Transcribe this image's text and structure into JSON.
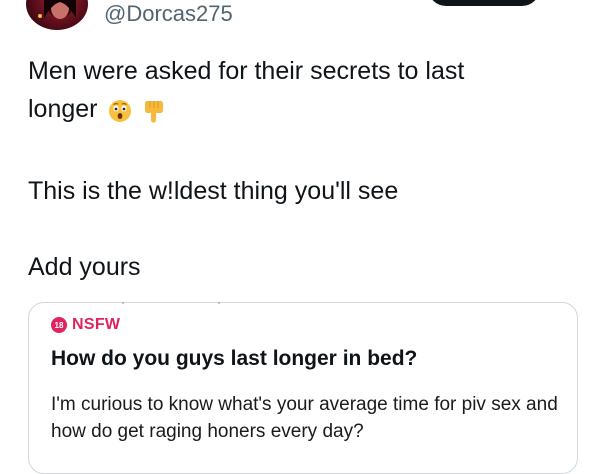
{
  "tweet": {
    "handle": "@Dorcas275",
    "text_line1": "Men were asked for their secrets to last",
    "text_line2": "longer",
    "emojis": [
      "astonished-face-emoji",
      "backhand-index-pointing-down-emoji"
    ],
    "paragraph2": "This is the w!ldest thing you'll see",
    "paragraph3": "Add yours"
  },
  "card": {
    "badge_number": "18",
    "badge_label": "NSFW",
    "title": "How do you guys last longer in bed?",
    "body": "I'm curious to know what's your average time for piv sex and how do get raging honers every day?"
  },
  "colors": {
    "text": "#0f1419",
    "secondary_text": "#536471",
    "nsfw": "#e0245e",
    "card_border": "#cfd9de"
  }
}
